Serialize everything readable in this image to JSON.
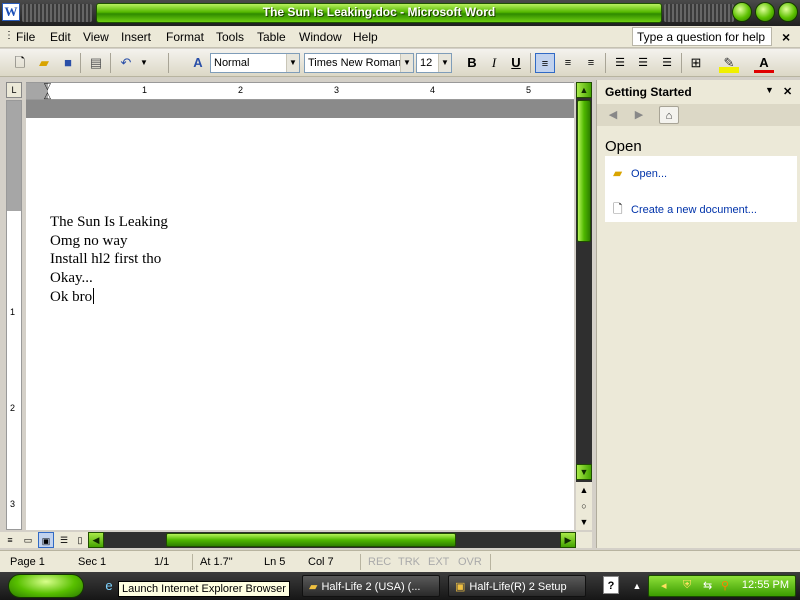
{
  "window": {
    "title": "The Sun Is Leaking.doc - Microsoft Word",
    "app_icon": "W"
  },
  "menu": {
    "items": [
      "File",
      "Edit",
      "View",
      "Insert",
      "Format",
      "Tools",
      "Table",
      "Window",
      "Help"
    ],
    "help_placeholder": "Type a question for help",
    "close_glyph": "×"
  },
  "toolbar": {
    "style": "Normal",
    "font": "Times New Roman",
    "size": "12",
    "bold": "B",
    "italic": "I",
    "underline": "U"
  },
  "ruler": {
    "corner": "L",
    "numbers": [
      "1",
      "2",
      "3",
      "4",
      "5"
    ],
    "vertical_numbers": [
      "1",
      "2",
      "3"
    ]
  },
  "document": {
    "lines": [
      "The Sun Is Leaking",
      "Omg no way",
      "Install hl2 first tho",
      "Okay...",
      "Ok bro"
    ]
  },
  "task_pane": {
    "title": "Getting Started",
    "section": "Open",
    "open_link": "Open...",
    "new_doc_link": "Create a new document..."
  },
  "status_bar": {
    "page": "Page  1",
    "sec": "Sec  1",
    "pages": "1/1",
    "at": "At  1.7\"",
    "ln": "Ln  5",
    "col": "Col  7",
    "rec": "REC",
    "trk": "TRK",
    "ext": "EXT",
    "ovr": "OVR"
  },
  "taskbar": {
    "tooltip": "Launch Internet Explorer Browser",
    "tasks": [
      "Half-Life 2 (USA) (...",
      "Half-Life(R) 2 Setup"
    ],
    "clock": "12:55 PM"
  },
  "colors": {
    "accent_green": "#55b800",
    "link_blue": "#0033aa"
  }
}
